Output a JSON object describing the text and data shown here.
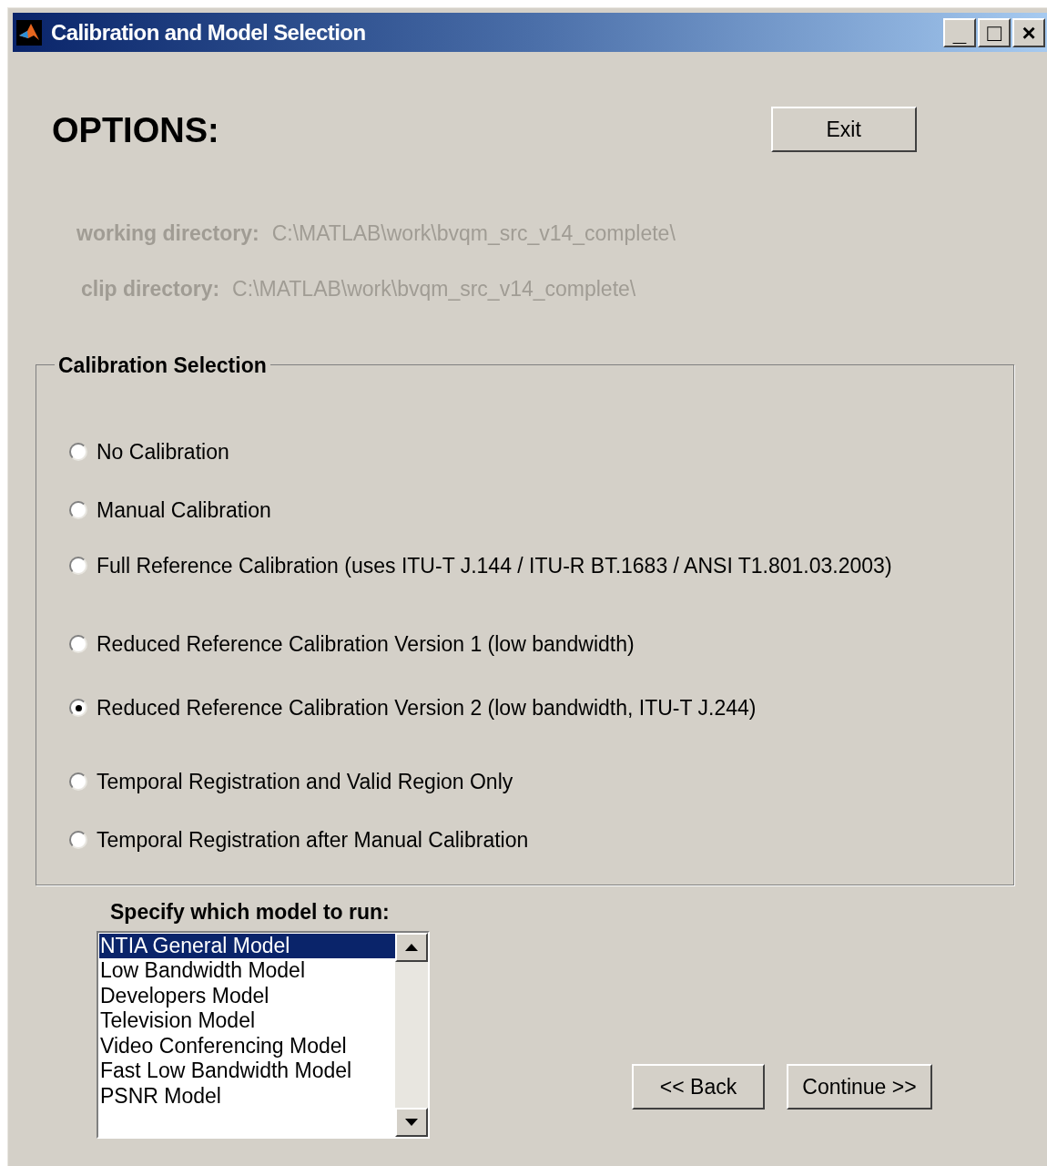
{
  "window": {
    "title": "Calibration and Model Selection",
    "controls": [
      "_",
      "□",
      "×"
    ]
  },
  "heading": "OPTIONS:",
  "exit_button": "Exit",
  "directories": [
    {
      "label": "working directory:",
      "value": "C:\\MATLAB\\work\\bvqm_src_v14_complete\\"
    },
    {
      "label": "clip directory:",
      "value": "C:\\MATLAB\\work\\bvqm_src_v14_complete\\"
    }
  ],
  "calibration": {
    "title": "Calibration Selection",
    "options": [
      {
        "label": "No Calibration",
        "selected": false
      },
      {
        "label": "Manual Calibration",
        "selected": false
      },
      {
        "label": "Full Reference Calibration (uses ITU-T J.144 / ITU-R BT.1683 / ANSI T1.801.03.2003)",
        "selected": false
      },
      {
        "label": "Reduced Reference Calibration Version 1 (low bandwidth)",
        "selected": false
      },
      {
        "label": "Reduced Reference Calibration Version 2 (low bandwidth, ITU-T J.244)",
        "selected": true
      },
      {
        "label": "Temporal Registration and Valid Region Only",
        "selected": false
      },
      {
        "label": "Temporal Registration after Manual Calibration",
        "selected": false
      }
    ]
  },
  "models": {
    "title": "Specify which model to run:",
    "items": [
      {
        "label": "NTIA General Model",
        "selected": true
      },
      {
        "label": "Low Bandwidth Model",
        "selected": false
      },
      {
        "label": "Developers Model",
        "selected": false
      },
      {
        "label": "Television Model",
        "selected": false
      },
      {
        "label": "Video Conferencing Model",
        "selected": false
      },
      {
        "label": "Fast Low Bandwidth Model",
        "selected": false
      },
      {
        "label": "PSNR Model",
        "selected": false
      }
    ]
  },
  "buttons": [
    "<< Back",
    "Continue >>"
  ]
}
